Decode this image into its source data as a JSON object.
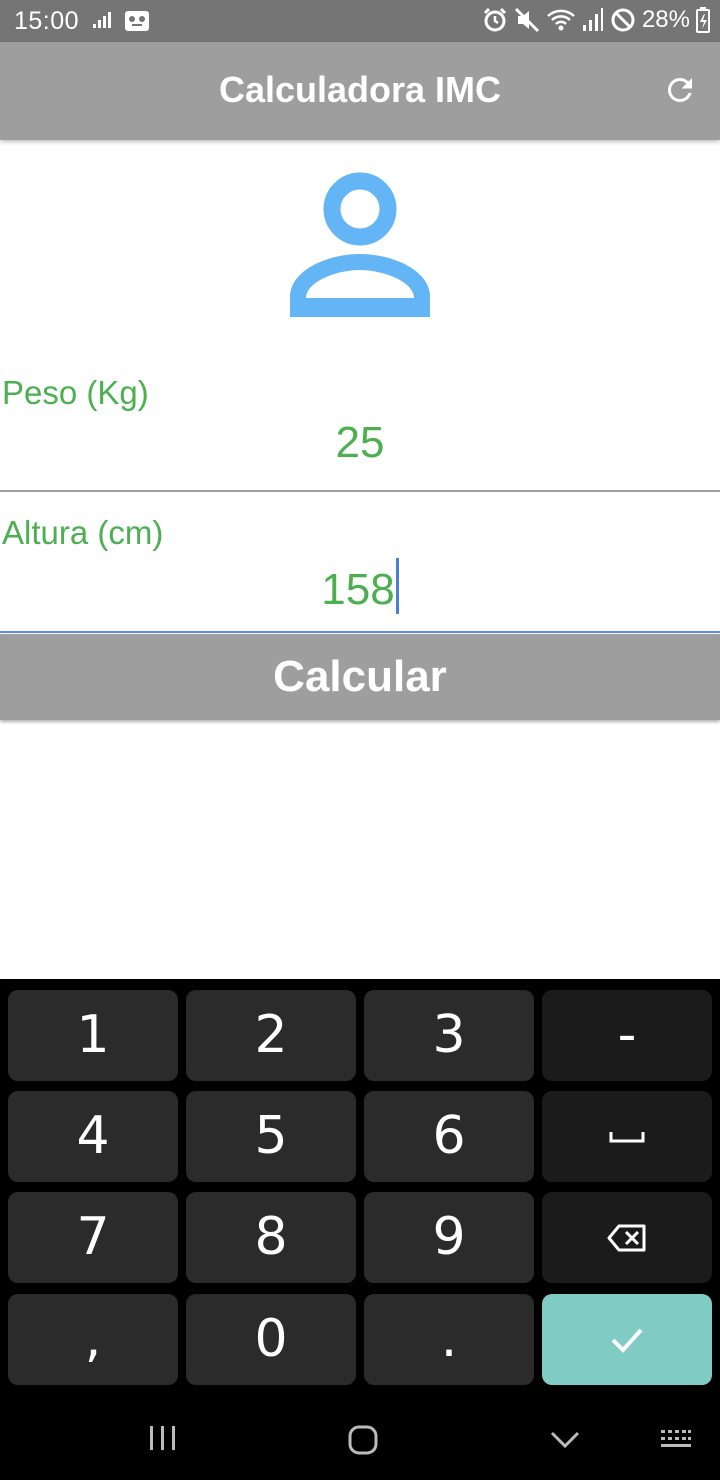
{
  "status_bar": {
    "time": "15:00",
    "battery": "28%",
    "icons": [
      "data-usage-icon",
      "voicemail-icon",
      "alarm-icon",
      "mute-icon",
      "wifi-icon",
      "signal-icon",
      "do-not-disturb-icon",
      "battery-icon"
    ]
  },
  "app_bar": {
    "title": "Calculadora IMC",
    "refresh_icon": "refresh-icon"
  },
  "form": {
    "avatar_icon": "person-icon",
    "accent_color": "#4caf50",
    "peso": {
      "label": "Peso (Kg)",
      "value": "25"
    },
    "altura": {
      "label": "Altura (cm)",
      "value": "158"
    },
    "calcular_label": "Calcular"
  },
  "keyboard": {
    "rows": [
      [
        "1",
        "2",
        "3",
        "-"
      ],
      [
        "4",
        "5",
        "6",
        "space"
      ],
      [
        "7",
        "8",
        "9",
        "backspace"
      ],
      [
        ",",
        "0",
        ".",
        "enter"
      ]
    ],
    "enter_color": "#80cbc4"
  },
  "nav_bar": {
    "items": [
      "recent-apps-icon",
      "home-icon",
      "back-icon",
      "keyboard-switch-icon"
    ]
  }
}
